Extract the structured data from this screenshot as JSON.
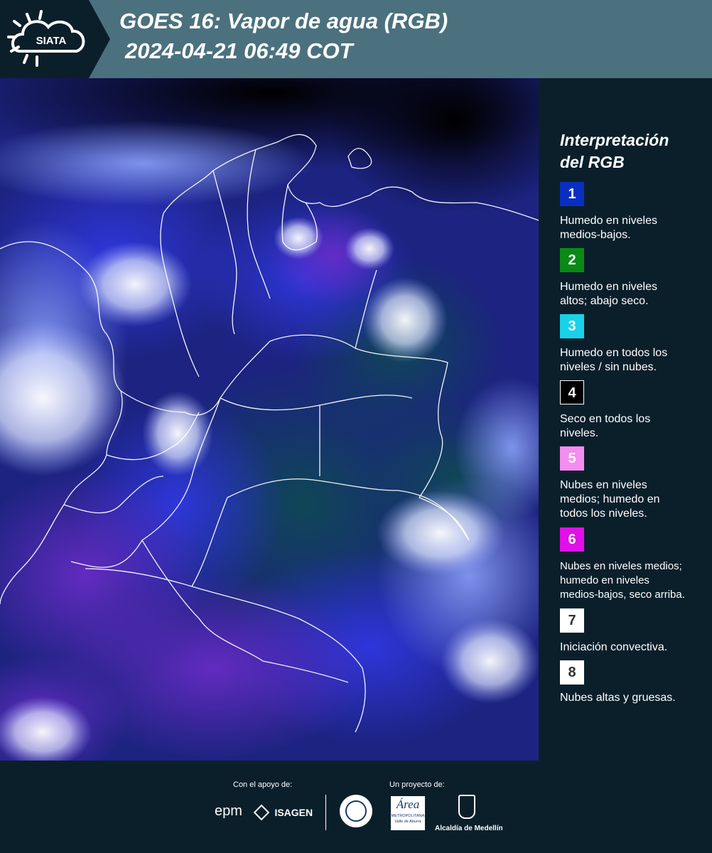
{
  "header": {
    "logo_text": "SIATA",
    "title_line1": "GOES 16: Vapor de agua (RGB)",
    "title_line2": "2024-04-21 06:49 COT"
  },
  "legend": {
    "title_line1": "Interpretación",
    "title_line2": "del RGB",
    "items": [
      {
        "num": "1",
        "color": "#0a2fc0",
        "numcolor": "#ffffff",
        "line1": "Humedo en niveles",
        "line2": "medios-bajos.",
        "line3": ""
      },
      {
        "num": "2",
        "color": "#0a8a14",
        "numcolor": "#ffffff",
        "line1": "Humedo en niveles",
        "line2": "altos; abajo seco.",
        "line3": ""
      },
      {
        "num": "3",
        "color": "#18d2ea",
        "numcolor": "#ffffff",
        "line1": "Humedo en todos los",
        "line2": "niveles / sin nubes.",
        "line3": ""
      },
      {
        "num": "4",
        "color": "#000000",
        "numcolor": "#ffffff",
        "line1": "Seco en todos los",
        "line2": "niveles.",
        "line3": ""
      },
      {
        "num": "5",
        "color": "#f58cf0",
        "numcolor": "#ffffff",
        "line1": "Nubes en niveles",
        "line2": "medios; humedo en",
        "line3": "todos los niveles."
      },
      {
        "num": "6",
        "color": "#e010e8",
        "numcolor": "#ffffff",
        "line1": "Nubes en niveles medios;",
        "line2": "humedo en niveles",
        "line3": "medios-bajos, seco arriba."
      },
      {
        "num": "7",
        "color": "#ffffff",
        "numcolor": "#333333",
        "line1": "Iniciación convectiva.",
        "line2": "",
        "line3": ""
      },
      {
        "num": "8",
        "color": "#ffffff",
        "numcolor": "#333333",
        "line1": "Nubes altas y gruesas.",
        "line2": "",
        "line3": ""
      }
    ]
  },
  "footer": {
    "support_label": "Con el apoyo de:",
    "project_label": "Un proyecto de:",
    "epm": "epm",
    "isagen": "ISAGEN",
    "metro_line1": "METROPOLITANA",
    "metro_line2": "Valle de Aburrá",
    "metro_area": "Área",
    "alcaldia": "Alcaldía de Medellín"
  }
}
